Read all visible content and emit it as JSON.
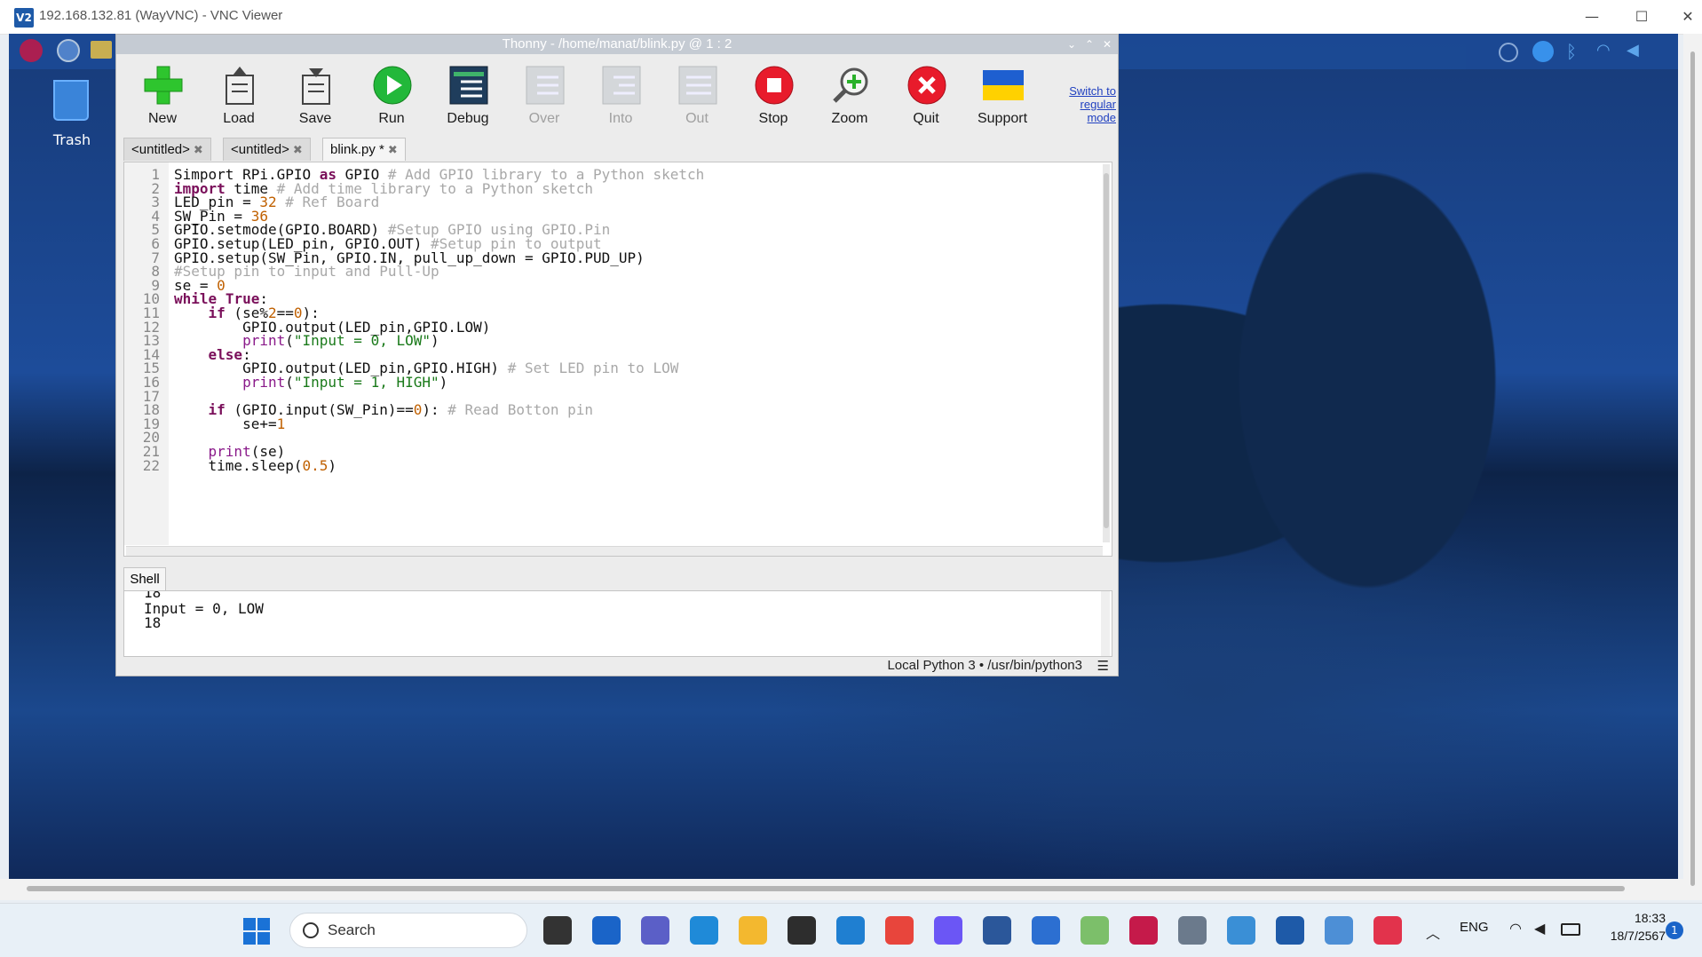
{
  "vnc": {
    "logo": "V2",
    "title": "192.168.132.81 (WayVNC) - VNC Viewer",
    "controls": [
      "—",
      "☐",
      "✕"
    ]
  },
  "desktop": {
    "trash_label": "Trash"
  },
  "thonny": {
    "title": "Thonny  -  /home/manat/blink.py  @  1 : 2",
    "title_controls": [
      "⌄",
      "⌃",
      "✕"
    ],
    "toolbar": [
      {
        "label": "New",
        "icon": "new-file-icon",
        "enabled": true
      },
      {
        "label": "Load",
        "icon": "load-icon",
        "enabled": true
      },
      {
        "label": "Save",
        "icon": "save-icon",
        "enabled": true
      },
      {
        "label": "Run",
        "icon": "run-icon",
        "enabled": true
      },
      {
        "label": "Debug",
        "icon": "debug-icon",
        "enabled": true
      },
      {
        "label": "Over",
        "icon": "step-over-icon",
        "enabled": false
      },
      {
        "label": "Into",
        "icon": "step-into-icon",
        "enabled": false
      },
      {
        "label": "Out",
        "icon": "step-out-icon",
        "enabled": false
      },
      {
        "label": "Stop",
        "icon": "stop-icon",
        "enabled": true
      },
      {
        "label": "Zoom",
        "icon": "zoom-icon",
        "enabled": true
      },
      {
        "label": "Quit",
        "icon": "quit-icon",
        "enabled": true
      },
      {
        "label": "Support",
        "icon": "ukraine-flag-icon",
        "enabled": true
      }
    ],
    "switch_mode": [
      "Switch to",
      "regular",
      "mode"
    ],
    "tabs": [
      {
        "label": "<untitled>",
        "close": "✖"
      },
      {
        "label": "<untitled>",
        "close": "✖"
      },
      {
        "label": "blink.py *",
        "close": "✖"
      }
    ],
    "editor": {
      "line_numbers": [
        "1",
        "2",
        "3",
        "4",
        "5",
        "6",
        "7",
        "8",
        "9",
        "10",
        "11",
        "12",
        "13",
        "14",
        "15",
        "16",
        "17",
        "18",
        "19",
        "20",
        "21",
        "22"
      ]
    },
    "shell": {
      "tab_label": "Shell",
      "lines": [
        "18",
        "Input = 0, LOW",
        "18"
      ]
    },
    "status": {
      "interpreter": "Local Python 3  •  /usr/bin/python3",
      "menu": "☰"
    }
  },
  "taskbar": {
    "search_label": "Search",
    "language": "ENG",
    "time": "18:33",
    "date": "18/7/2567",
    "notifications": "1",
    "apps": [
      "task-view-icon",
      "snap-icon",
      "teams-icon",
      "edge-icon",
      "file-explorer-icon",
      "store-icon",
      "vscode-icon",
      "chrome-icon",
      "messenger-icon",
      "word-icon",
      "notepad-icon",
      "maps-icon",
      "raspberry-pi-icon",
      "settings-icon",
      "remote-desktop-icon",
      "vnc-viewer-icon",
      "network-icon",
      "snipping-tool-icon"
    ]
  },
  "colors": {
    "keyword": "#7a0f5a",
    "comment": "#a8a8a8",
    "number": "#c06000",
    "string": "#1a7a1a",
    "accent": "#1a64c8"
  }
}
